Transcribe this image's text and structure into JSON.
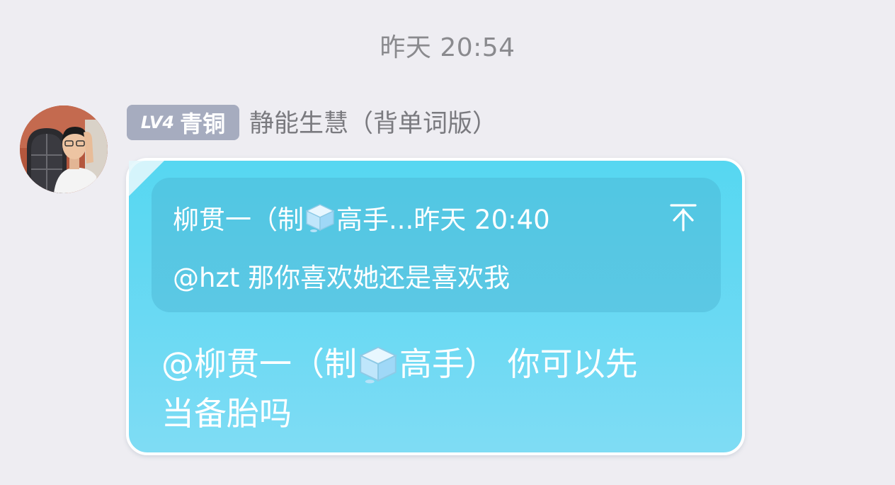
{
  "timestamp": "昨天 20:54",
  "sender": {
    "level": "LV4",
    "rank": "青铜",
    "name": "静能生慧（背单词版）"
  },
  "reply": {
    "quoted_author_pre": "柳贯一（制",
    "quoted_author_post": "高手...",
    "quoted_time": "昨天 20:40",
    "quoted_text": "@hzt 那你喜欢她还是喜欢我",
    "pin_icon": "jump-to-top-icon"
  },
  "message": {
    "line1_pre": "@柳贯一（制",
    "line1_post": "高手） 你可以先",
    "line2": "当备胎吗"
  },
  "colors": {
    "background": "#eeedf2",
    "bubble": "#5fd8f2",
    "badge": "#a6acbf"
  }
}
